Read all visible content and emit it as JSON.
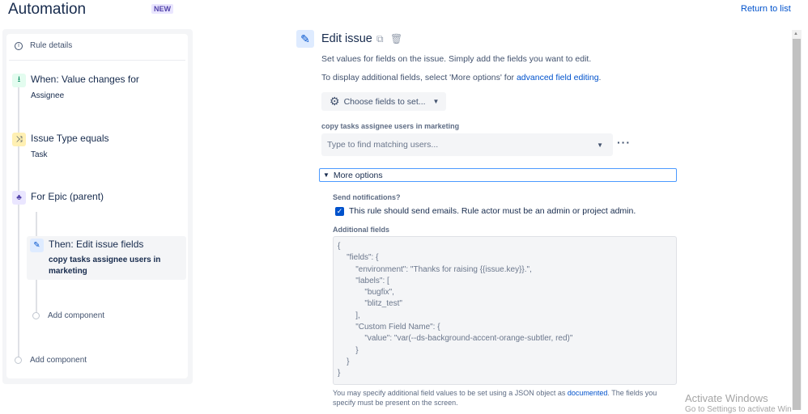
{
  "header": {
    "title": "Automation",
    "badge": "NEW",
    "return_link": "Return to list"
  },
  "sidebar": {
    "rule_details": "Rule details",
    "steps": [
      {
        "title": "When: Value changes for",
        "subtitle": "Assignee",
        "color": "#e3fcef"
      },
      {
        "title": "Issue Type equals",
        "subtitle": "Task",
        "color": "#fff0b3"
      },
      {
        "title": "For Epic (parent)",
        "color": "#eae6ff"
      },
      {
        "title": "Then: Edit issue fields",
        "subtitle": "copy tasks assignee users in marketing",
        "color": "#deebff"
      }
    ],
    "add_component_inner": "Add component",
    "add_component_outer": "Add component"
  },
  "main": {
    "title": "Edit issue",
    "desc1": "Set values for fields on the issue. Simply add the fields you want to edit.",
    "desc2_pre": "To display additional fields, select 'More options' for ",
    "desc2_link": "advanced field editing",
    "desc2_post": ".",
    "choose_fields": "Choose fields to set...",
    "field_label": "copy tasks assignee users in marketing",
    "user_placeholder": "Type to find matching users...",
    "more_options": "More options",
    "send_notifications": "Send notifications?",
    "checkbox_label": "This rule should send emails. Rule actor must be an admin or project admin.",
    "checkbox_checked": true,
    "additional_fields": "Additional fields",
    "json_value": "{\n    \"fields\": {\n        \"environment\": \"Thanks for raising {{issue.key}}.\",\n        \"labels\": [\n            \"bugfix\",\n            \"blitz_test\"\n        ],\n        \"Custom Field Name\": {\n            \"value\": \"var(--ds-background-accent-orange-subtler, red)\"\n        }\n    }\n}",
    "help_pre": "You may specify additional field values to be set using a JSON object as ",
    "help_link": "documented",
    "help_post": ". The fields you specify must be present on the screen."
  },
  "watermark": {
    "line1": "Activate Windows",
    "line2": "Go to Settings to activate Windows."
  }
}
